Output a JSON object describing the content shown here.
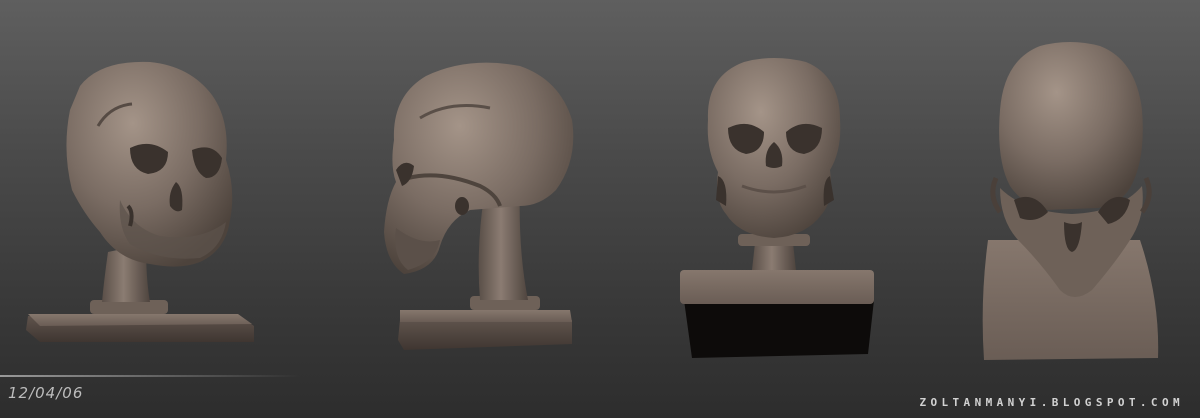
{
  "scene": {
    "background_top": "#5f5f5f",
    "background_bottom": "#2d2d2d",
    "sculpt_color": "#7a6c63",
    "sculpt_shadow": "#453c36",
    "sculpt_highlight": "#9c8d83",
    "views": [
      {
        "id": "three-quarter",
        "icon": "skull-three-quarter-icon"
      },
      {
        "id": "side",
        "icon": "skull-side-icon"
      },
      {
        "id": "front",
        "icon": "skull-front-icon"
      },
      {
        "id": "top",
        "icon": "skull-top-icon"
      }
    ]
  },
  "overlay": {
    "date": "12/04/06",
    "watermark": "ZOLTANMANYI.BLOGSPOT.COM"
  }
}
